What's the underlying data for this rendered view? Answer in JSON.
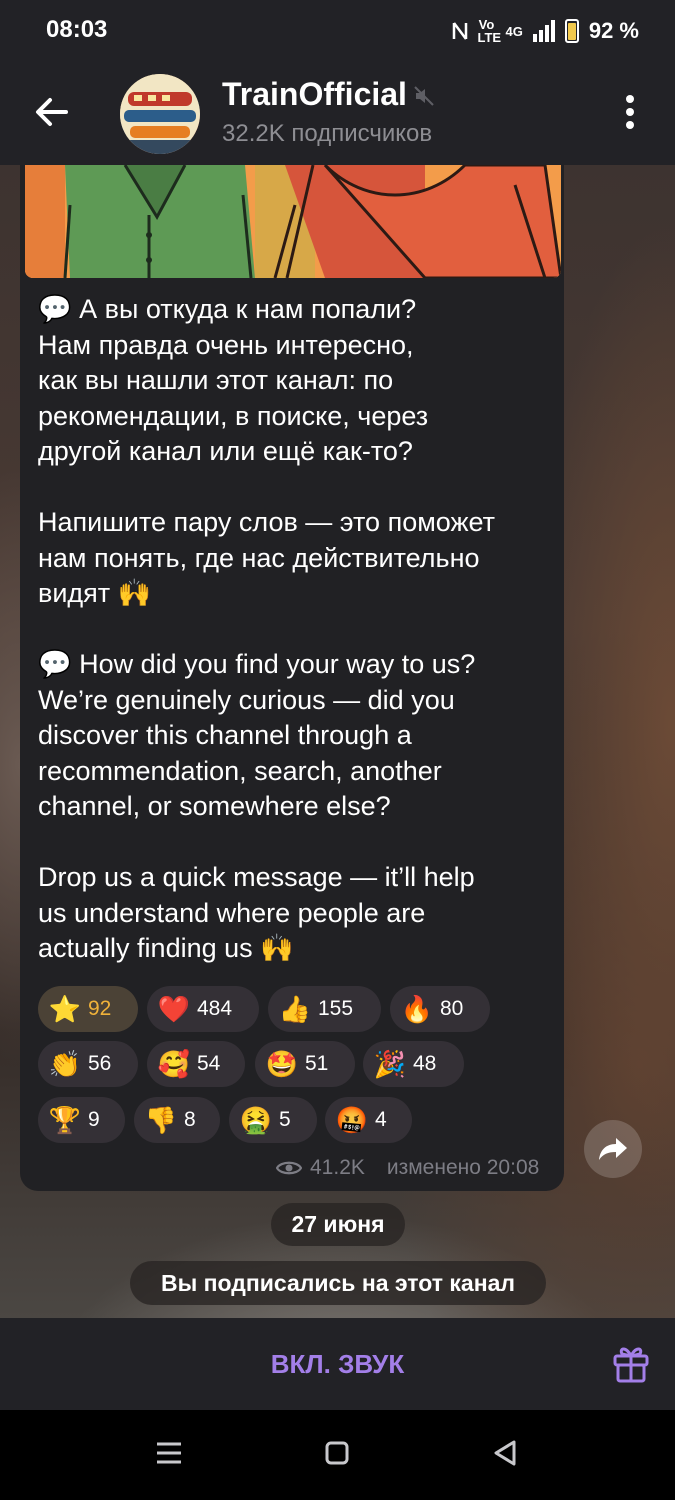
{
  "status_bar": {
    "time": "08:03",
    "battery": "92 %",
    "network": "4G",
    "volte": "Vo LTE"
  },
  "header": {
    "title": "TrainOfficial",
    "subtitle": "32.2K подписчиков"
  },
  "message": {
    "text": "💬 А вы откуда к нам попали?\nНам правда очень интересно,\nкак вы нашли этот канал: по\nрекомендации, в поиске, через\nдругой канал или ещё как-то?\n\nНапишите пару слов — это поможет\nнам понять, где нас действительно\nвидят 🙌\n\n💬 How did you find your way to us?\nWe’re genuinely curious — did you\ndiscover this channel through a\nrecommendation, search, another\nchannel, or somewhere else?\n\nDrop us a quick message — it’ll help\nus understand where people are\nactually finding us 🙌",
    "reactions": [
      {
        "emoji": "⭐",
        "count": "92",
        "active": true
      },
      {
        "emoji": "❤️",
        "count": "484"
      },
      {
        "emoji": "👍",
        "count": "155"
      },
      {
        "emoji": "🔥",
        "count": "80"
      },
      {
        "emoji": "👏",
        "count": "56"
      },
      {
        "emoji": "🥰",
        "count": "54"
      },
      {
        "emoji": "🤩",
        "count": "51"
      },
      {
        "emoji": "🎉",
        "count": "48"
      },
      {
        "emoji": "🏆",
        "count": "9"
      },
      {
        "emoji": "👎",
        "count": "8"
      },
      {
        "emoji": "🤮",
        "count": "5"
      },
      {
        "emoji": "🤬",
        "count": "4"
      }
    ],
    "views": "41.2K",
    "edited": "изменено 20:08"
  },
  "date_separator": "27 июня",
  "service_message": "Вы подписались на этот канал",
  "bottom_bar": {
    "unmute_label": "ВКЛ. ЗВУК"
  },
  "colors": {
    "accent": "#a37fe8",
    "star_count": "#f0b23a",
    "bubble": "#212124"
  },
  "icons": [
    "back-arrow-icon",
    "mute-icon",
    "more-vert-icon",
    "eye-icon",
    "share-icon",
    "gift-icon",
    "nav-menu-icon",
    "nav-home-icon",
    "nav-back-icon"
  ]
}
